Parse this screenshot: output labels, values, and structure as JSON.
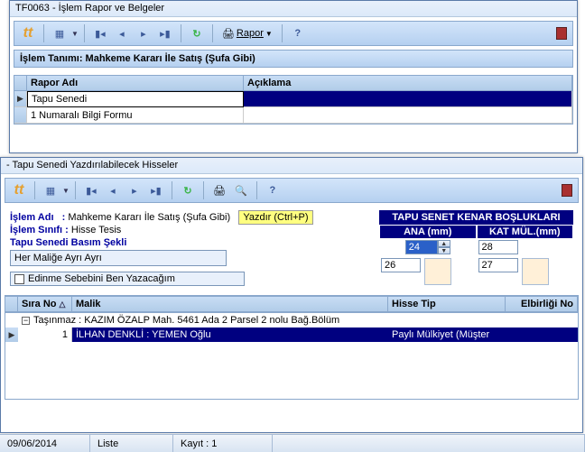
{
  "win1": {
    "title": "TF0063 - İşlem Rapor ve Belgeler",
    "rapor_label": "Rapor",
    "info": "İşlem Tanımı: Mahkeme Kararı İle Satış (Şufa Gibi)",
    "columns": {
      "rapor_adi": "Rapor Adı",
      "aciklama": "Açıklama"
    },
    "rows": [
      {
        "rapor_adi": "Tapu Senedi",
        "aciklama": ""
      },
      {
        "rapor_adi": "1 Numaralı Bilgi Formu",
        "aciklama": ""
      }
    ]
  },
  "win2": {
    "title": "- Tapu Senedi Yazdırılabilecek Hisseler",
    "islem_adi_lbl": "İşlem Adı",
    "islem_adi_val": "Mahkeme Kararı İle Satış (Şufa Gibi)",
    "yazdir": "Yazdır (Ctrl+P)",
    "islem_sinifi_lbl": "İşlem Sınıfı",
    "islem_sinifi_val": "Hisse Tesis",
    "basim_sekli_lbl": "Tapu Senedi Basım Şekli",
    "basim_sekli_val": "Her Maliğe Ayrı Ayrı",
    "edinme_chk": "Edinme Sebebini Ben Yazacağım",
    "margins": {
      "title": "TAPU SENET KENAR BOŞLUKLARI",
      "ana": "ANA (mm)",
      "kat": "KAT MÜL.(mm)",
      "v_top_left": "24",
      "v_top_right": "28",
      "v_bot_left": "26",
      "v_bot_right": "27"
    },
    "grid": {
      "cols": {
        "sira": "Sıra No",
        "malik": "Malik",
        "hisse": "Hisse Tip",
        "elbir": "Elbirliği No"
      },
      "group": "Taşınmaz : KAZIM ÖZALP Mah. 5461 Ada 2 Parsel 2 nolu Bağ.Bölüm",
      "row": {
        "sira": "1",
        "malik": "İLHAN DENKLİ : YEMEN Oğlu",
        "hisse": "Paylı Mülkiyet (Müşter",
        "elbir": ""
      }
    }
  },
  "status": {
    "date": "09/06/2014",
    "mode": "Liste",
    "kayit": "Kayıt : 1"
  }
}
